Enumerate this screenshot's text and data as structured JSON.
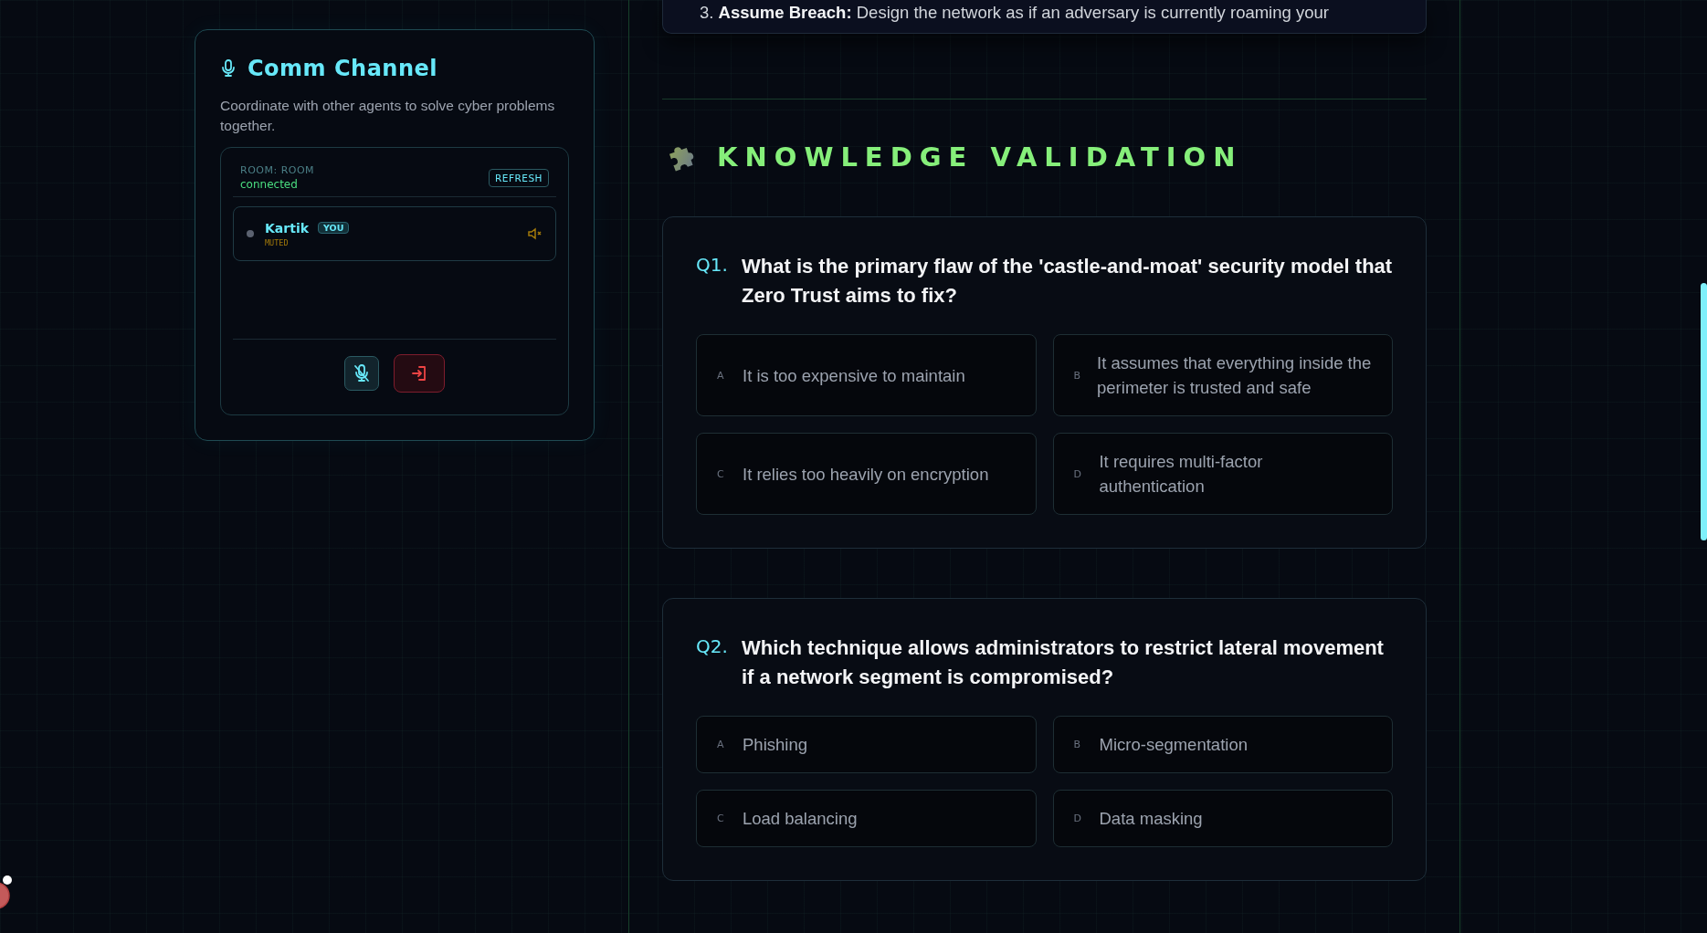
{
  "comm_channel": {
    "title": "Comm Channel",
    "description": "Coordinate with other agents to solve cyber problems together.",
    "room": {
      "label": "ROOM: ROOM",
      "status": "connected",
      "refresh_button": "REFRESH"
    },
    "participants": [
      {
        "name": "Kartik",
        "badge": "YOU",
        "status": "MUTED",
        "muted": true
      }
    ],
    "controls": [
      {
        "kind": "mic"
      },
      {
        "kind": "leave"
      }
    ]
  },
  "lesson": {
    "item_number": "3.",
    "text": "**Assume Breach:** Design the network as if an adversary is currently roaming your"
  },
  "quiz": {
    "heading": "KNOWLEDGE VALIDATION",
    "questions": [
      {
        "number": "Q1.",
        "text": "What is the primary flaw of the 'castle-and-moat' security model that Zero Trust aims to fix?",
        "options": [
          {
            "letter": "A",
            "text": "It is too expensive to maintain"
          },
          {
            "letter": "B",
            "text": "It assumes that everything inside the perimeter is trusted and safe"
          },
          {
            "letter": "C",
            "text": "It relies too heavily on encryption"
          },
          {
            "letter": "D",
            "text": "It requires multi-factor authentication"
          }
        ]
      },
      {
        "number": "Q2.",
        "text": "Which technique allows administrators to restrict lateral movement if a network segment is compromised?",
        "options": [
          {
            "letter": "A",
            "text": "Phishing"
          },
          {
            "letter": "B",
            "text": "Micro-segmentation"
          },
          {
            "letter": "C",
            "text": "Load balancing"
          },
          {
            "letter": "D",
            "text": "Data masking"
          }
        ]
      }
    ]
  }
}
